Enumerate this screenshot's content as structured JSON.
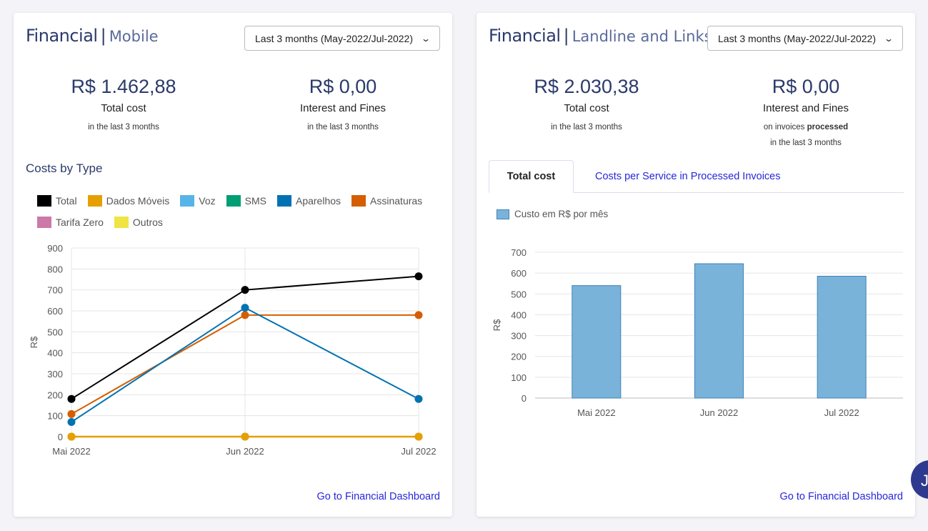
{
  "mobile_card": {
    "title_bold": "Financial",
    "title_light": "Mobile",
    "period_select": "Last 3 months (May-2022/Jul-2022)",
    "total_cost": {
      "value": "R$ 1.462,88",
      "label": "Total cost",
      "sub": "in the last 3 months"
    },
    "interest": {
      "value": "R$ 0,00",
      "label": "Interest and Fines",
      "sub": "in the last 3 months"
    },
    "section_title": "Costs by Type",
    "legend": [
      {
        "name": "Total",
        "color": "#000000"
      },
      {
        "name": "Dados Móveis",
        "color": "#e69f00"
      },
      {
        "name": "Voz",
        "color": "#56b4e9"
      },
      {
        "name": "SMS",
        "color": "#009e73"
      },
      {
        "name": "Aparelhos",
        "color": "#0072b2"
      },
      {
        "name": "Assinaturas",
        "color": "#d55e00"
      },
      {
        "name": "Tarifa Zero",
        "color": "#cc79a7"
      },
      {
        "name": "Outros",
        "color": "#f0e442"
      }
    ],
    "footer_link": "Go to Financial Dashboard"
  },
  "landline_card": {
    "title_bold": "Financial",
    "title_light": "Landline and Links",
    "period_select": "Last 3 months (May-2022/Jul-2022)",
    "total_cost": {
      "value": "R$ 2.030,38",
      "label": "Total cost",
      "sub": "in the last 3 months"
    },
    "interest": {
      "value": "R$ 0,00",
      "label": "Interest and Fines",
      "sub_prefix": "on invoices",
      "sub_bold": "processed",
      "sub2": "in the last 3 months"
    },
    "tabs": [
      "Total cost",
      "Costs per Service in Processed Invoices"
    ],
    "bar_legend": "Custo em R$ por mês",
    "footer_link": "Go to Financial Dashboard"
  },
  "chat_icon": "chat-bubble-icon",
  "chart_data": [
    {
      "type": "line",
      "ylabel": "R$",
      "ylim": [
        0,
        900
      ],
      "yticks": [
        0,
        100,
        200,
        300,
        400,
        500,
        600,
        700,
        800,
        900
      ],
      "categories": [
        "Mai 2022",
        "Jun 2022",
        "Jul 2022"
      ],
      "grid": true,
      "series": [
        {
          "name": "Total",
          "color": "#000000",
          "values": [
            180,
            700,
            765
          ]
        },
        {
          "name": "Dados Móveis",
          "color": "#e69f00",
          "values": [
            0,
            0,
            0
          ]
        },
        {
          "name": "Voz",
          "color": "#56b4e9",
          "values": [
            0,
            0,
            0
          ]
        },
        {
          "name": "SMS",
          "color": "#009e73",
          "values": [
            0,
            0,
            0
          ]
        },
        {
          "name": "Aparelhos",
          "color": "#0072b2",
          "values": [
            70,
            615,
            180
          ]
        },
        {
          "name": "Assinaturas",
          "color": "#d55e00",
          "values": [
            108,
            580,
            580
          ]
        },
        {
          "name": "Tarifa Zero",
          "color": "#cc79a7",
          "values": [
            0,
            0,
            0
          ]
        },
        {
          "name": "Outros",
          "color": "#f0e442",
          "values": [
            0,
            0,
            0
          ]
        }
      ]
    },
    {
      "type": "bar",
      "ylabel": "R$",
      "ylim": [
        0,
        700
      ],
      "yticks": [
        0,
        100,
        200,
        300,
        400,
        500,
        600,
        700
      ],
      "categories": [
        "Mai 2022",
        "Jun 2022",
        "Jul 2022"
      ],
      "grid": true,
      "series": [
        {
          "name": "Custo em R$ por mês",
          "color": "#7ab3da",
          "values": [
            540,
            645,
            585
          ]
        }
      ]
    }
  ]
}
